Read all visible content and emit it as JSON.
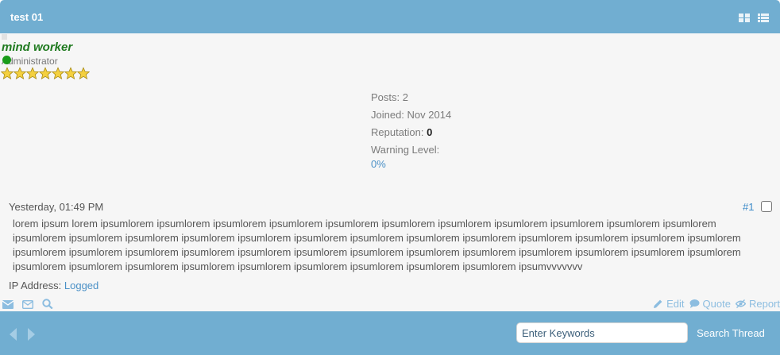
{
  "thread": {
    "title": "test 01"
  },
  "author": {
    "username": "mind worker",
    "user_title": "Administrator",
    "star_count": 7,
    "stats": {
      "posts_label": "Posts:",
      "posts_value": "2",
      "joined_label": "Joined:",
      "joined_value": "Nov 2014",
      "reputation_label": "Reputation:",
      "reputation_value": "0",
      "warning_label": "Warning Level:",
      "warning_value": "0%"
    }
  },
  "post": {
    "date": "Yesterday, 01:49 PM",
    "number": "#1",
    "content": "lorem ipsum lorem ipsumlorem ipsumlorem ipsumlorem ipsumlorem ipsumlorem ipsumlorem ipsumlorem ipsumlorem ipsumlorem ipsumlorem ipsumlorem ipsumlorem ipsumlorem ipsumlorem ipsumlorem ipsumlorem ipsumlorem ipsumlorem ipsumlorem ipsumlorem ipsumlorem ipsumlorem ipsumlorem ipsumlorem ipsumlorem ipsumlorem ipsumlorem ipsumlorem ipsumlorem ipsumlorem ipsumlorem ipsumlorem ipsumlorem ipsumlorem ipsumlorem ipsumlorem ipsumlorem ipsumlorem ipsumlorem ipsumlorem ipsumlorem ipsumlorem ipsumlorem ipsumlorem ipsumlorem ipsumlorem ipsumvvvvvvv",
    "ip_label": "IP Address:",
    "ip_value": "Logged",
    "tools": {
      "edit": "Edit",
      "quote": "Quote",
      "report": "Report"
    }
  },
  "footer": {
    "search_placeholder": "Enter Keywords",
    "search_button": "Search Thread"
  },
  "colors": {
    "bar": "#71aed1",
    "username": "#1f7a1f",
    "link": "#4a90c6"
  },
  "icons": {
    "view_grid": "grid-view-icon",
    "view_list": "list-view-icon",
    "email": "email-icon",
    "pm": "envelope-icon",
    "find": "search-icon",
    "edit": "pencil-icon",
    "quote": "speech-bubble-icon",
    "report": "eye-slash-icon",
    "prev": "chevron-left-icon",
    "next": "chevron-right-icon"
  }
}
